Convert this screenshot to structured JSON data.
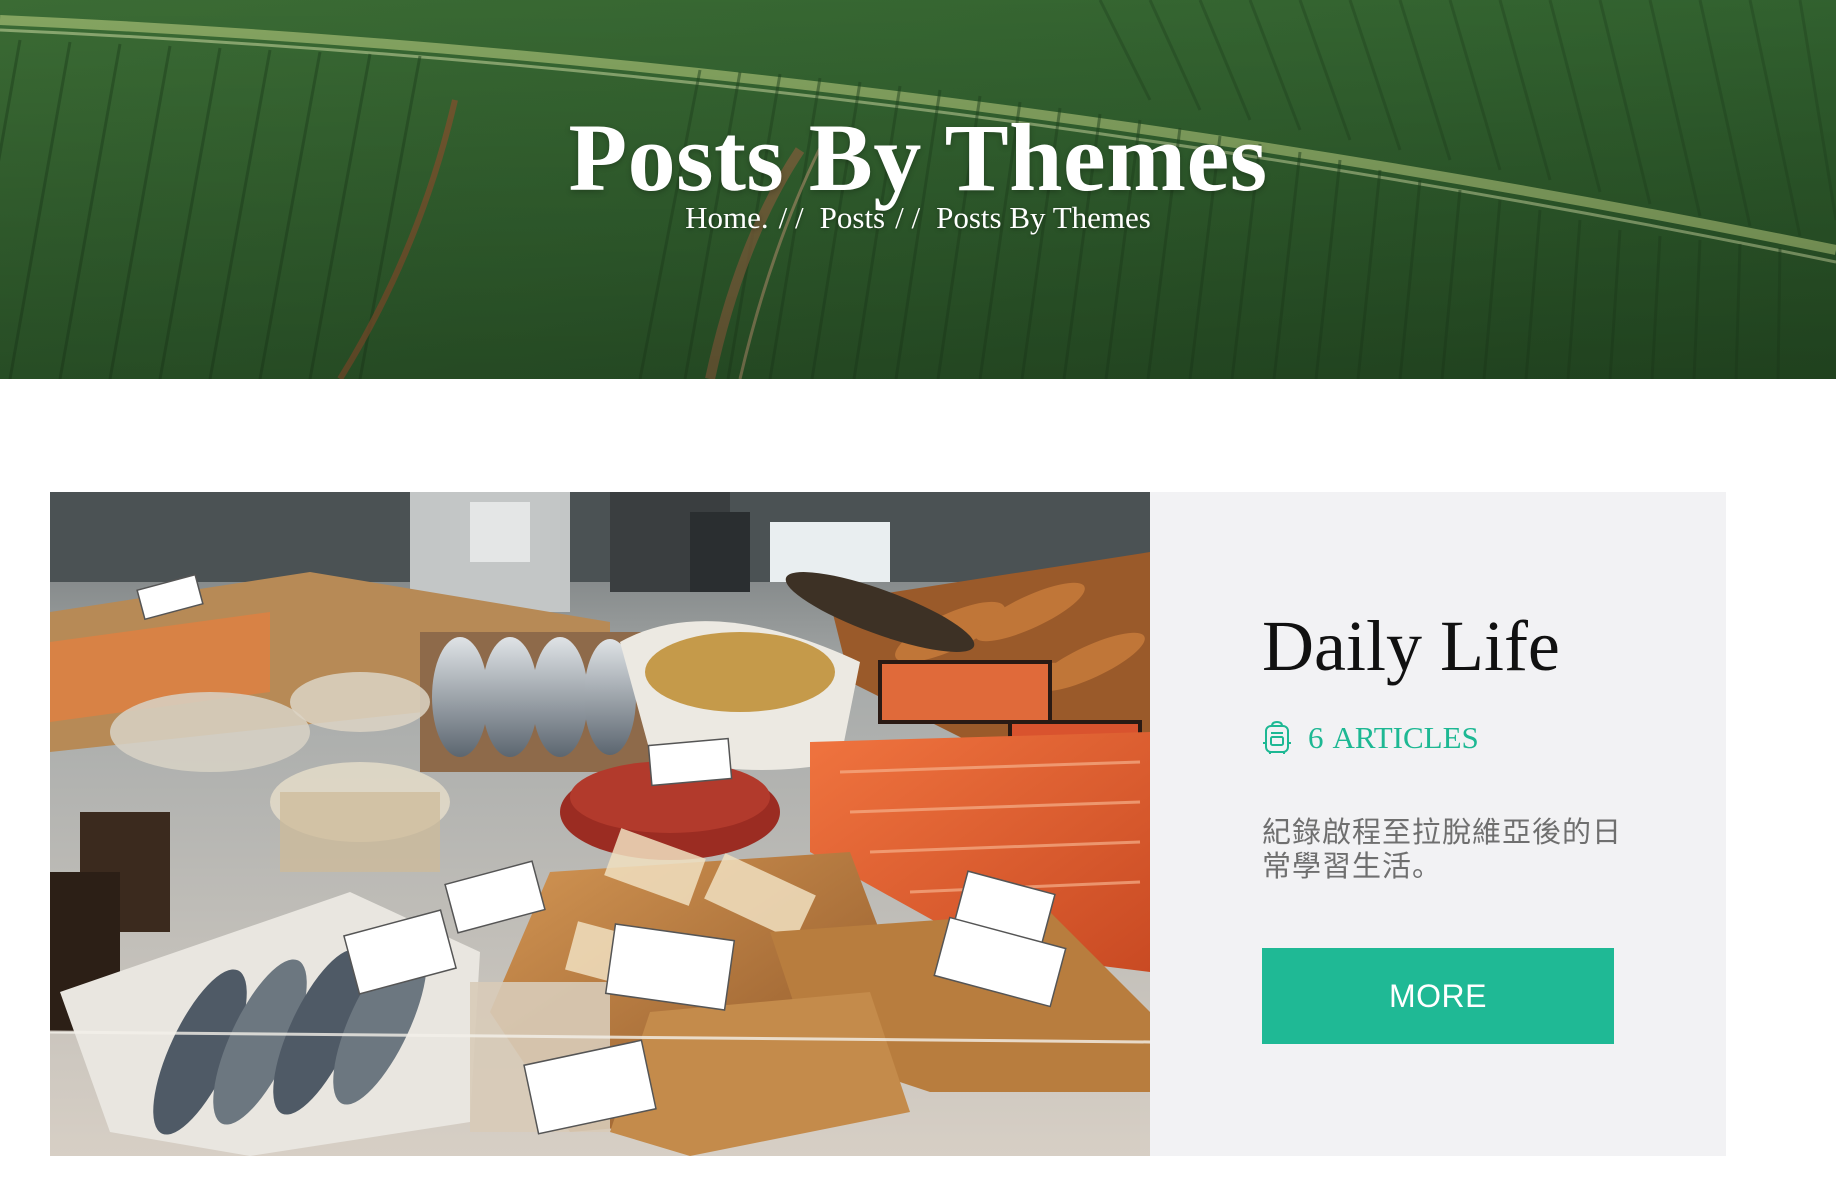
{
  "hero": {
    "title": "Posts By Themes",
    "breadcrumb": [
      {
        "label": "Home."
      },
      {
        "label": "Posts"
      },
      {
        "label": "Posts By Themes"
      }
    ],
    "separator": "/ /"
  },
  "theme_card": {
    "title": "Daily Life",
    "article_count": "6",
    "article_label": "ARTICLES",
    "article_icon": "backpack-icon",
    "description": "紀錄啟程至拉脫維亞後的日常學習生活。",
    "more_label": "MORE",
    "accent_color": "#1fb995",
    "image_subject": "fish-market-counter-photo"
  }
}
